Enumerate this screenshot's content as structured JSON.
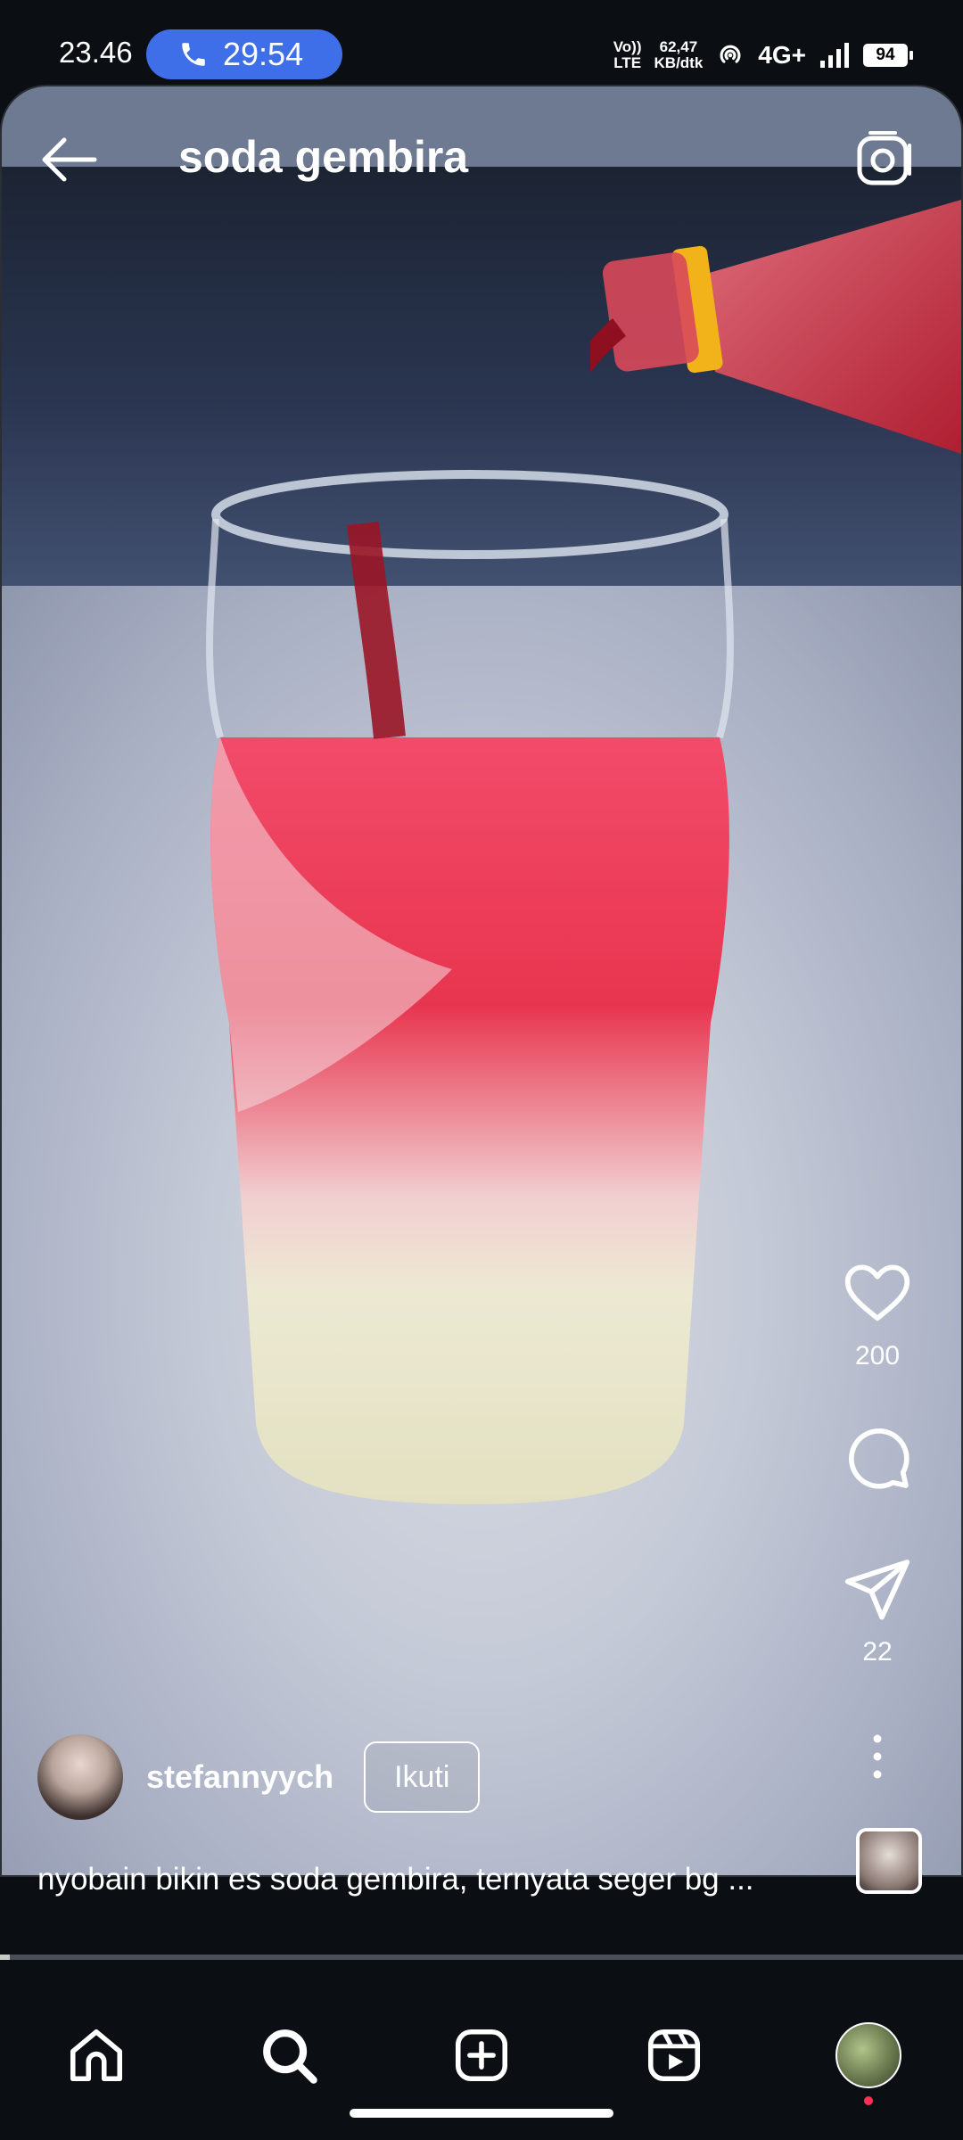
{
  "status_bar": {
    "time": "23.46",
    "call_duration": "29:54",
    "volte_top": "Vo))",
    "volte_bottom": "LTE",
    "net_speed_value": "62,47",
    "net_speed_unit": "KB/dtk",
    "network_type": "4G+",
    "battery": "94"
  },
  "header": {
    "title": "soda gembira",
    "back_icon": "arrow-left-icon",
    "camera_icon": "camera-icon"
  },
  "actions": {
    "like_count": "200",
    "share_count": "22",
    "like_icon": "heart-icon",
    "comment_icon": "comment-icon",
    "share_icon": "send-icon",
    "more_icon": "more-vertical-icon"
  },
  "post": {
    "author": "stefannyych",
    "follow_label": "Ikuti",
    "caption": "nyobain bikin es soda gembira, ternyata seger bg ..."
  },
  "playback": {
    "progress_fraction": 0.01
  },
  "nav": {
    "items": [
      "home-icon",
      "search-icon",
      "add-icon",
      "reels-icon",
      "profile-avatar"
    ]
  },
  "colors": {
    "call_pill": "#3f6fe8",
    "background": "#0b0f14",
    "notification_dot": "#ff2f55"
  }
}
